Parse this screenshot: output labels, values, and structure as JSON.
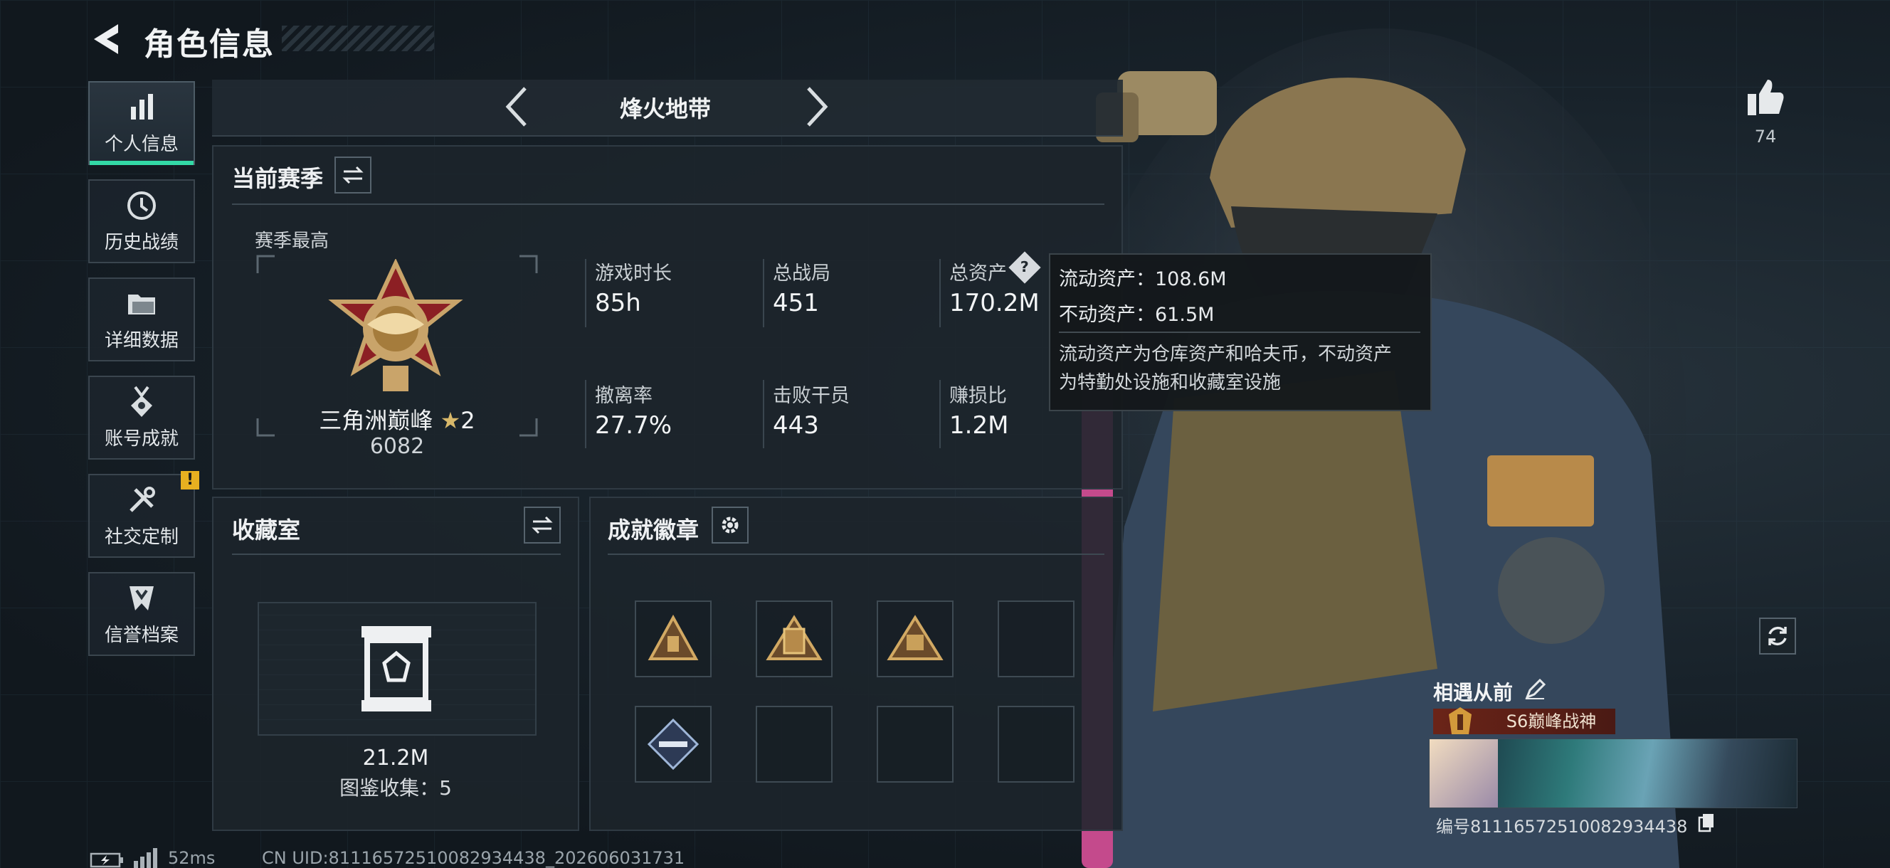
{
  "header": {
    "title": "角色信息"
  },
  "sidebar": {
    "items": [
      {
        "label": "个人信息",
        "icon": "bar-chart-icon"
      },
      {
        "label": "历史战绩",
        "icon": "clock-icon"
      },
      {
        "label": "详细数据",
        "icon": "folder-icon"
      },
      {
        "label": "账号成就",
        "icon": "medal-icon"
      },
      {
        "label": "社交定制",
        "icon": "tools-icon"
      },
      {
        "label": "信誉档案",
        "icon": "shield-icon"
      }
    ],
    "warning_badge": "!"
  },
  "mode_tab": {
    "label": "烽火地带"
  },
  "season": {
    "title": "当前赛季",
    "best_label": "赛季最高",
    "rank_name": "三角洲巅峰",
    "rank_star": "★",
    "rank_level": "2",
    "rank_score": "6082",
    "stats": [
      {
        "label": "游戏时长",
        "value": "85h"
      },
      {
        "label": "总战局",
        "value": "451"
      },
      {
        "label": "总资产",
        "value": "170.2M"
      },
      {
        "label": "撤离率",
        "value": "27.7%"
      },
      {
        "label": "击败干员",
        "value": "443"
      },
      {
        "label": "赚损比",
        "value": "1.2M"
      }
    ],
    "help_icon": "?"
  },
  "tooltip": {
    "liquid": "流动资产：108.6M",
    "fixed": "不动资产：61.5M",
    "desc_line1": "流动资产为仓库资产和哈夫币，不动资产",
    "desc_line2": "为特勤处设施和收藏室设施"
  },
  "collection": {
    "title": "收藏室",
    "value": "21.2M",
    "catalog_label": "图鉴收集：5"
  },
  "badges": {
    "title": "成就徽章",
    "slot_count": 8
  },
  "profile": {
    "likes": "74",
    "player_name": "相遇从前",
    "title_badge": "S6巅峰战神",
    "id_label": "编号8111657251008293443​8"
  },
  "footer": {
    "ping": "52ms",
    "uid": "CN UID:8111657251008293443​8_202606031731"
  },
  "colors": {
    "accent": "#33d9a6",
    "gold": "#c9a46a",
    "warning": "#e8b020"
  }
}
